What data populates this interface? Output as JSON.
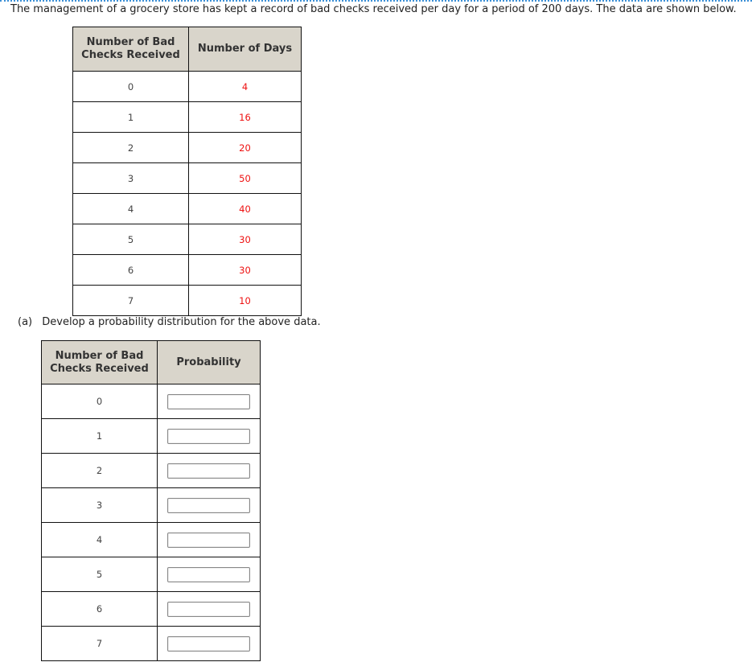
{
  "intro_text": "The management of a grocery store has kept a record of bad checks received per day for a period of 200 days. The data are shown below.",
  "data_table": {
    "headers": [
      "Number of Bad Checks Received",
      "Number of Days"
    ],
    "rows": [
      {
        "checks": "0",
        "days": "4"
      },
      {
        "checks": "1",
        "days": "16"
      },
      {
        "checks": "2",
        "days": "20"
      },
      {
        "checks": "3",
        "days": "50"
      },
      {
        "checks": "4",
        "days": "40"
      },
      {
        "checks": "5",
        "days": "30"
      },
      {
        "checks": "6",
        "days": "30"
      },
      {
        "checks": "7",
        "days": "10"
      }
    ],
    "value_color": "#ee1111"
  },
  "question": {
    "label": "(a)",
    "text": "Develop a probability distribution for the above data."
  },
  "answer_table": {
    "headers": [
      "Number of Bad Checks Received",
      "Probability"
    ],
    "rows": [
      {
        "checks": "0",
        "probability": ""
      },
      {
        "checks": "1",
        "probability": ""
      },
      {
        "checks": "2",
        "probability": ""
      },
      {
        "checks": "3",
        "probability": ""
      },
      {
        "checks": "4",
        "probability": ""
      },
      {
        "checks": "5",
        "probability": ""
      },
      {
        "checks": "6",
        "probability": ""
      },
      {
        "checks": "7",
        "probability": ""
      }
    ]
  }
}
